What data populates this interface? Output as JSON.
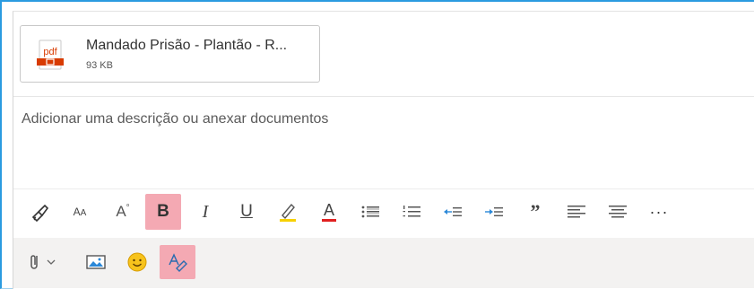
{
  "attachment": {
    "icon": "pdf-file-icon",
    "icon_text": "pdf",
    "name": "Mandado Prisão - Plantão - R...",
    "size": "93 KB"
  },
  "description": {
    "placeholder": "Adicionar uma descrição ou anexar documentos"
  },
  "format_toolbar": {
    "bold_label": "B",
    "italic_label": "I",
    "underline_label": "U",
    "font_color_label": "A",
    "font_size_label": "AA",
    "more_label": "···",
    "quote_label": "”",
    "active_color": "#f4a9b3"
  },
  "bottom_toolbar": {
    "items": [
      "attach-icon",
      "image-icon",
      "emoji-icon",
      "format-icon"
    ]
  }
}
